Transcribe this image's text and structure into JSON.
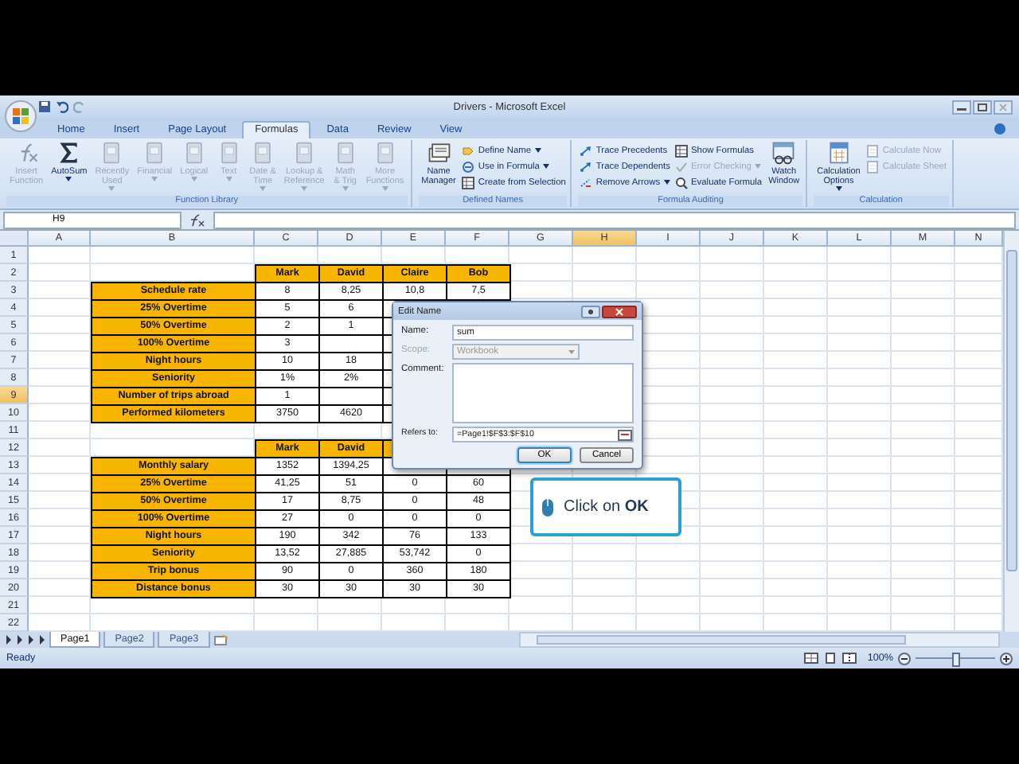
{
  "window": {
    "title": "Drivers - Microsoft Excel"
  },
  "tabs": [
    {
      "label": "Home",
      "selected": false
    },
    {
      "label": "Insert",
      "selected": false
    },
    {
      "label": "Page Layout",
      "selected": false
    },
    {
      "label": "Formulas",
      "selected": true
    },
    {
      "label": "Data",
      "selected": false
    },
    {
      "label": "Review",
      "selected": false
    },
    {
      "label": "View",
      "selected": false
    }
  ],
  "ribbon": [
    {
      "label": "Function Library",
      "items": [
        {
          "kind": "function",
          "lines": [
            "Insert",
            "Function"
          ],
          "disabled": true,
          "dropdown": false
        },
        {
          "kind": "sum",
          "lines": [
            "AutoSum"
          ],
          "disabled": false,
          "dropdown": true
        },
        {
          "kind": "category",
          "lines": [
            "Recently",
            "Used"
          ],
          "disabled": true,
          "dropdown": true
        },
        {
          "kind": "category",
          "lines": [
            "Financial"
          ],
          "disabled": true,
          "dropdown": true
        },
        {
          "kind": "category",
          "lines": [
            "Logical"
          ],
          "disabled": true,
          "dropdown": true
        },
        {
          "kind": "category",
          "lines": [
            "Text"
          ],
          "disabled": true,
          "dropdown": true
        },
        {
          "kind": "category",
          "lines": [
            "Date &",
            "Time"
          ],
          "disabled": true,
          "dropdown": true
        },
        {
          "kind": "category",
          "lines": [
            "Lookup &",
            "Reference"
          ],
          "disabled": true,
          "dropdown": true
        },
        {
          "kind": "category",
          "lines": [
            "Math",
            "& Trig"
          ],
          "disabled": true,
          "dropdown": true
        },
        {
          "kind": "category",
          "lines": [
            "More",
            "Functions"
          ],
          "disabled": true,
          "dropdown": true
        }
      ]
    },
    {
      "label": "Defined Names",
      "items": [
        {
          "kind": "names",
          "lines": [
            "Name",
            "Manager"
          ],
          "disabled": false,
          "dropdown": false
        },
        {
          "kind": "stack",
          "buttons": [
            {
              "kind": "tag",
              "label": "Define Name",
              "disabled": false,
              "dropdown": true
            },
            {
              "kind": "formula",
              "label": "Use in Formula",
              "disabled": false,
              "dropdown": true
            },
            {
              "kind": "grid",
              "label": "Create from Selection",
              "disabled": false,
              "dropdown": false
            }
          ]
        }
      ]
    },
    {
      "label": "Formula Auditing",
      "items": [
        {
          "kind": "stack",
          "buttons": [
            {
              "kind": "arrow",
              "label": "Trace Precedents",
              "disabled": false,
              "dropdown": false
            },
            {
              "kind": "arrow",
              "label": "Trace Dependents",
              "disabled": false,
              "dropdown": false
            },
            {
              "kind": "remove",
              "label": "Remove Arrows",
              "disabled": false,
              "dropdown": true
            }
          ]
        },
        {
          "kind": "stack",
          "buttons": [
            {
              "kind": "grid",
              "label": "Show Formulas",
              "disabled": false,
              "dropdown": false
            },
            {
              "kind": "check",
              "label": "Error Checking",
              "disabled": true,
              "dropdown": true
            },
            {
              "kind": "magnifier",
              "label": "Evaluate Formula",
              "disabled": false,
              "dropdown": false
            }
          ]
        },
        {
          "kind": "watch",
          "lines": [
            "Watch",
            "Window"
          ],
          "disabled": false,
          "dropdown": false
        }
      ]
    },
    {
      "label": "Calculation",
      "items": [
        {
          "kind": "calc",
          "lines": [
            "Calculation",
            "Options"
          ],
          "disabled": false,
          "dropdown": true
        },
        {
          "kind": "stack",
          "buttons": [
            {
              "kind": "calc",
              "label": "Calculate Now",
              "disabled": true,
              "dropdown": false
            },
            {
              "kind": "calc",
              "label": "Calculate Sheet",
              "disabled": true,
              "dropdown": false
            }
          ]
        }
      ]
    }
  ],
  "formula_bar": {
    "name_box": "H9"
  },
  "sheet": {
    "columns": [
      {
        "label": "A",
        "selected": false
      },
      {
        "label": "B",
        "selected": false
      },
      {
        "label": "C",
        "selected": false
      },
      {
        "label": "D",
        "selected": false
      },
      {
        "label": "E",
        "selected": false
      },
      {
        "label": "F",
        "selected": false
      },
      {
        "label": "G",
        "selected": false
      },
      {
        "label": "H",
        "selected": true
      },
      {
        "label": "I",
        "selected": false
      },
      {
        "label": "J",
        "selected": false
      },
      {
        "label": "K",
        "selected": false
      },
      {
        "label": "L",
        "selected": false
      },
      {
        "label": "M",
        "selected": false
      },
      {
        "label": "N",
        "selected": false
      }
    ],
    "rows": [
      {
        "label": "1",
        "selected": false,
        "kind": "blank"
      },
      {
        "label": "2",
        "selected": false,
        "kind": "header",
        "values": [
          "Mark",
          "David",
          "Claire",
          "Bob"
        ]
      },
      {
        "label": "3",
        "selected": false,
        "kind": "data",
        "name": "Schedule rate",
        "values": [
          "8",
          "8,25",
          "10,8",
          "7,5"
        ]
      },
      {
        "label": "4",
        "selected": false,
        "kind": "data",
        "name": "25% Overtime",
        "values": [
          "5",
          "6"
        ]
      },
      {
        "label": "5",
        "selected": false,
        "kind": "data",
        "name": "50% Overtime",
        "values": [
          "2",
          "1"
        ]
      },
      {
        "label": "6",
        "selected": false,
        "kind": "data",
        "name": "100% Overtime",
        "values": [
          "3"
        ]
      },
      {
        "label": "7",
        "selected": false,
        "kind": "data",
        "name": "Night hours",
        "values": [
          "10",
          "18"
        ]
      },
      {
        "label": "8",
        "selected": false,
        "kind": "data",
        "name": "Seniority",
        "values": [
          "1%",
          "2%"
        ]
      },
      {
        "label": "9",
        "selected": true,
        "kind": "data",
        "name": "Number of trips abroad",
        "values": [
          "1"
        ]
      },
      {
        "label": "10",
        "selected": false,
        "kind": "data",
        "name": "Performed kilometers",
        "values": [
          "3750",
          "4620"
        ]
      },
      {
        "label": "11",
        "selected": false,
        "kind": "blank"
      },
      {
        "label": "12",
        "selected": false,
        "kind": "header",
        "values": [
          "Mark",
          "David"
        ]
      },
      {
        "label": "13",
        "selected": false,
        "kind": "data",
        "name": "Monthly salary",
        "values": [
          "1352",
          "1394,25"
        ]
      },
      {
        "label": "14",
        "selected": false,
        "kind": "data",
        "name": "25% Overtime",
        "values": [
          "41,25",
          "51",
          "0",
          "60"
        ]
      },
      {
        "label": "15",
        "selected": false,
        "kind": "data",
        "name": "50% Overtime",
        "values": [
          "17",
          "8,75",
          "0",
          "48"
        ]
      },
      {
        "label": "16",
        "selected": false,
        "kind": "data",
        "name": "100% Overtime",
        "values": [
          "27",
          "0",
          "0",
          "0"
        ]
      },
      {
        "label": "17",
        "selected": false,
        "kind": "data",
        "name": "Night hours",
        "values": [
          "190",
          "342",
          "76",
          "133"
        ]
      },
      {
        "label": "18",
        "selected": false,
        "kind": "data",
        "name": "Seniority",
        "values": [
          "13,52",
          "27,885",
          "53,742",
          "0"
        ]
      },
      {
        "label": "19",
        "selected": false,
        "kind": "data",
        "name": "Trip bonus",
        "values": [
          "90",
          "0",
          "360",
          "180"
        ]
      },
      {
        "label": "20",
        "selected": false,
        "kind": "data",
        "name": "Distance bonus",
        "values": [
          "30",
          "30",
          "30",
          "30"
        ]
      },
      {
        "label": "21",
        "selected": false,
        "kind": "blank"
      },
      {
        "label": "22",
        "selected": false,
        "kind": "blank"
      }
    ]
  },
  "sheet_tabs": [
    {
      "label": "Page1",
      "selected": true
    },
    {
      "label": "Page2",
      "selected": false
    },
    {
      "label": "Page3",
      "selected": false
    }
  ],
  "status_bar": {
    "text": "Ready",
    "zoom": "100%",
    "level": 0.5
  },
  "dialog": {
    "title": "Edit Name",
    "fields": [
      {
        "kind": "text",
        "label": "Name:",
        "value": "sum",
        "disabled": false
      },
      {
        "kind": "select",
        "label": "Scope:",
        "value": "Workbook",
        "disabled": true
      },
      {
        "kind": "textarea",
        "label": "Comment:",
        "disabled": false
      },
      {
        "kind": "ref",
        "label": "Refers to:",
        "value": "=Page1!$F$3:$F$10",
        "disabled": false
      }
    ],
    "buttons": [
      {
        "label": "OK",
        "default": true
      },
      {
        "label": "Cancel",
        "default": false
      }
    ]
  },
  "callout": {
    "text": "Click on **OK**"
  }
}
